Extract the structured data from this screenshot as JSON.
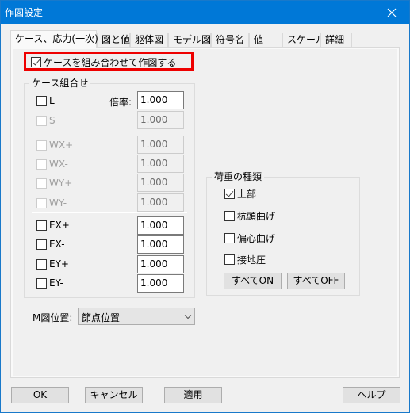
{
  "window": {
    "title": "作図設定",
    "close_icon": "close-icon"
  },
  "tabs": [
    {
      "label": "ケース、応力(一次)",
      "active": true
    },
    {
      "label": "図と値"
    },
    {
      "label": "躯体図"
    },
    {
      "label": "モデル図"
    },
    {
      "label": "符号名"
    },
    {
      "label": "値"
    },
    {
      "label": "スケール"
    },
    {
      "label": "詳細"
    }
  ],
  "combine_checkbox": {
    "label": "ケースを組み合わせて作図する",
    "checked": true
  },
  "case_group": {
    "title": "ケース組合せ",
    "ratio_label": "倍率:",
    "rows": [
      {
        "label": "L",
        "checked": false,
        "enabled": true,
        "value": "1.000"
      },
      {
        "label": "S",
        "checked": false,
        "enabled": false,
        "value": "1.000"
      },
      {
        "label": "WX+",
        "checked": false,
        "enabled": false,
        "value": "1.000"
      },
      {
        "label": "WX-",
        "checked": false,
        "enabled": false,
        "value": "1.000"
      },
      {
        "label": "WY+",
        "checked": false,
        "enabled": false,
        "value": "1.000"
      },
      {
        "label": "WY-",
        "checked": false,
        "enabled": false,
        "value": "1.000"
      },
      {
        "label": "EX+",
        "checked": false,
        "enabled": true,
        "value": "1.000"
      },
      {
        "label": "EX-",
        "checked": false,
        "enabled": true,
        "value": "1.000"
      },
      {
        "label": "EY+",
        "checked": false,
        "enabled": true,
        "value": "1.000"
      },
      {
        "label": "EY-",
        "checked": false,
        "enabled": true,
        "value": "1.000"
      }
    ]
  },
  "m_position": {
    "label": "M図位置:",
    "selected": "節点位置"
  },
  "load_group": {
    "title": "荷重の種類",
    "items": [
      {
        "label": "上部",
        "checked": true
      },
      {
        "label": "杭頭曲げ",
        "checked": false
      },
      {
        "label": "偏心曲げ",
        "checked": false
      },
      {
        "label": "接地圧",
        "checked": false
      }
    ],
    "all_on": "すべてON",
    "all_off": "すべてOFF"
  },
  "footer": {
    "ok": "OK",
    "cancel": "キャンセル",
    "apply": "適用",
    "help": "ヘルプ"
  }
}
